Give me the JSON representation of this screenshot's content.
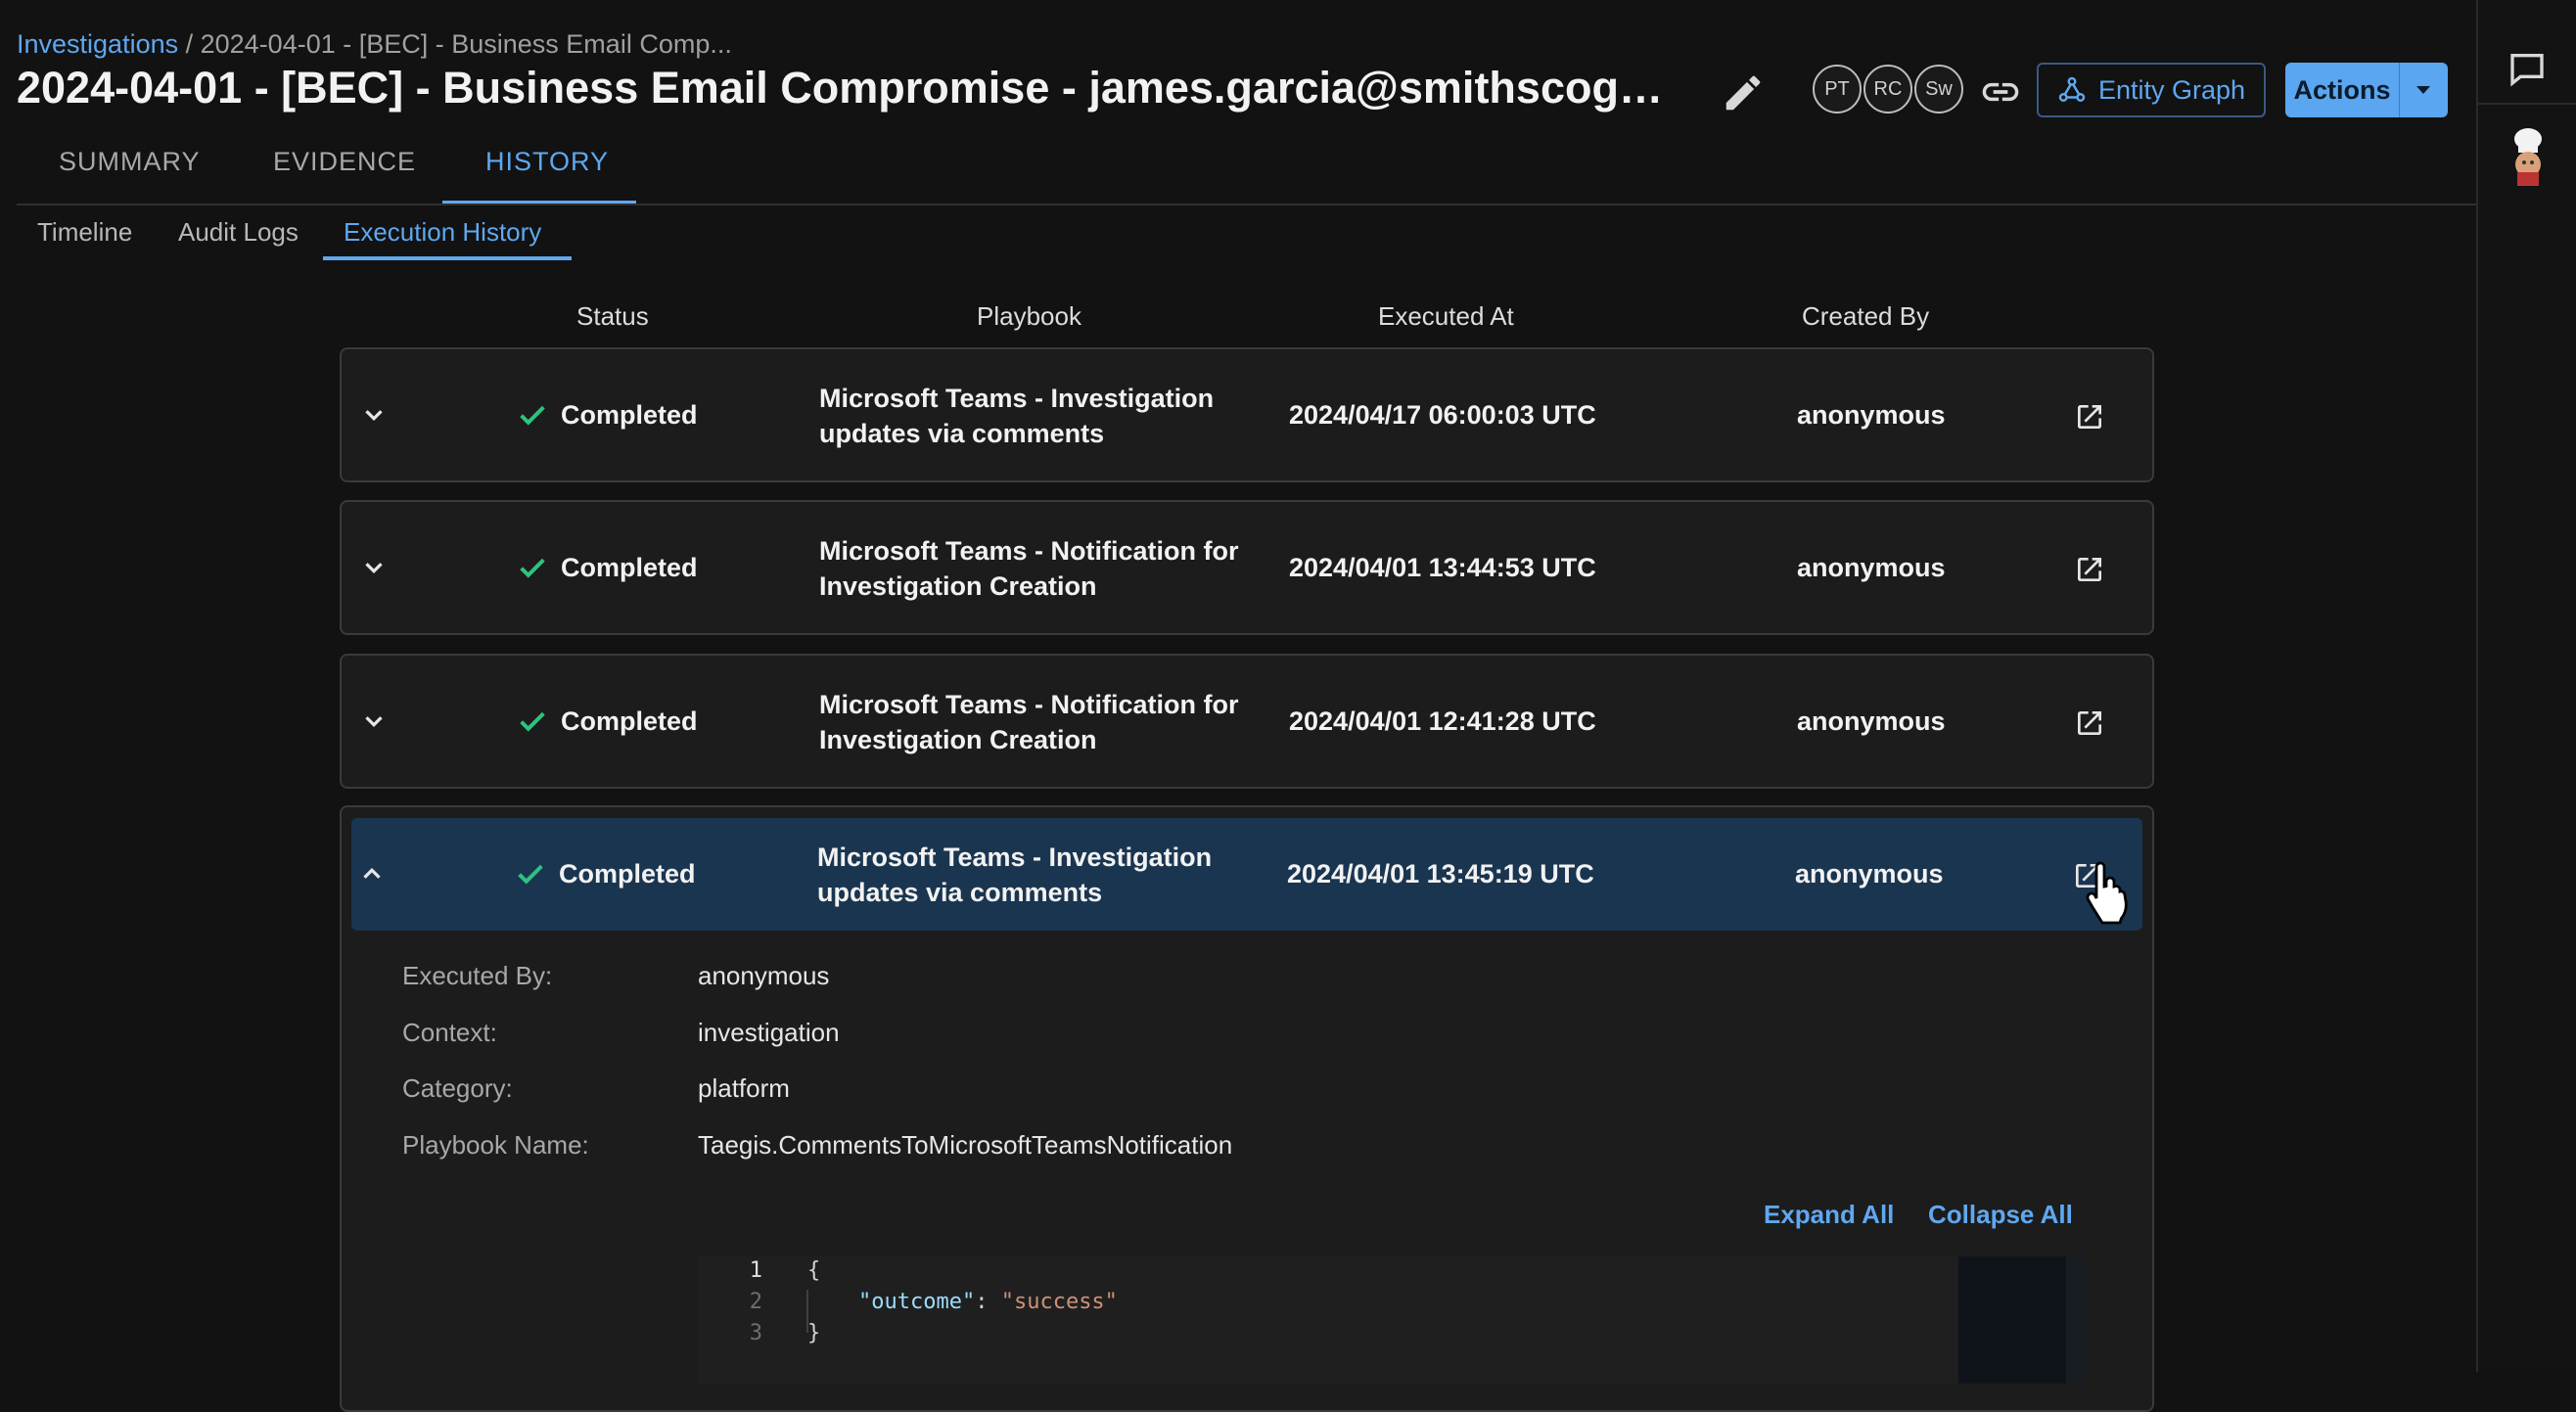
{
  "breadcrumb": {
    "root": "Investigations",
    "sep": " / ",
    "current": "2024-04-01 - [BEC] - Business Email Comp..."
  },
  "title": "2024-04-01 - [BEC] - Business Email Compromise - james.garcia@smithscogwheel...",
  "avatars": [
    "PT",
    "RC",
    "Sw"
  ],
  "buttons": {
    "entity_graph": "Entity Graph",
    "actions": "Actions"
  },
  "tabs": [
    "SUMMARY",
    "EVIDENCE",
    "HISTORY"
  ],
  "active_tab": "HISTORY",
  "subtabs": [
    "Timeline",
    "Audit Logs",
    "Execution History"
  ],
  "active_subtab": "Execution History",
  "table": {
    "headers": [
      "Status",
      "Playbook",
      "Executed At",
      "Created By"
    ],
    "rows": [
      {
        "status": "Completed",
        "playbook_line1": "Microsoft Teams - Investigation",
        "playbook_line2": "updates via comments",
        "executed_at": "2024/04/17 06:00:03 UTC",
        "created_by": "anonymous"
      },
      {
        "status": "Completed",
        "playbook_line1": "Microsoft Teams - Notification for",
        "playbook_line2": "Investigation Creation",
        "executed_at": "2024/04/01 13:44:53 UTC",
        "created_by": "anonymous"
      },
      {
        "status": "Completed",
        "playbook_line1": "Microsoft Teams - Notification for",
        "playbook_line2": "Investigation Creation",
        "executed_at": "2024/04/01 12:41:28 UTC",
        "created_by": "anonymous"
      },
      {
        "status": "Completed",
        "playbook_line1": "Microsoft Teams - Investigation",
        "playbook_line2": "updates via comments",
        "executed_at": "2024/04/01 13:45:19 UTC",
        "created_by": "anonymous"
      }
    ]
  },
  "details": {
    "executed_by_label": "Executed By:",
    "executed_by": "anonymous",
    "context_label": "Context:",
    "context": "investigation",
    "category_label": "Category:",
    "category": "platform",
    "playbook_name_label": "Playbook Name:",
    "playbook_name": "Taegis.CommentsToMicrosoftTeamsNotification"
  },
  "code_actions": {
    "expand_all": "Expand All",
    "collapse_all": "Collapse All"
  },
  "code": {
    "line_numbers": [
      "1",
      "2",
      "3"
    ],
    "open": "{",
    "key": "\"outcome\"",
    "colon": ": ",
    "value": "\"success\"",
    "close": "}"
  },
  "colors": {
    "accent": "#5fa8f0",
    "success": "#2ec27e",
    "expanded_row": "#1a3550"
  }
}
